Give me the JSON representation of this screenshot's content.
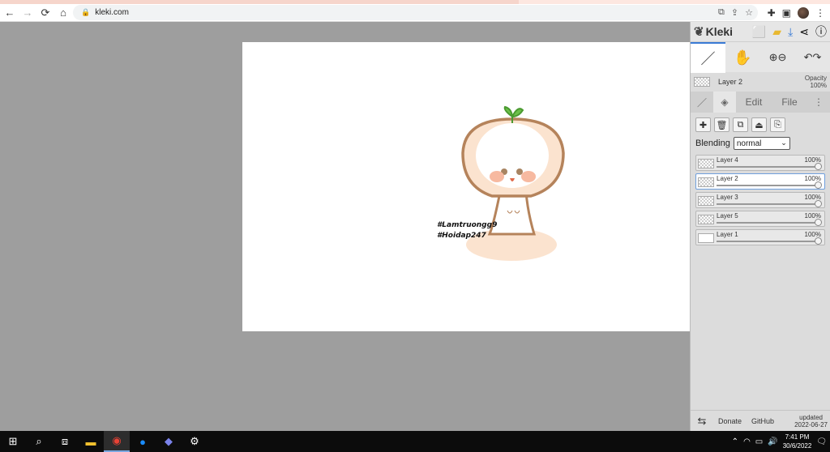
{
  "browser": {
    "url": "kleki.com",
    "nav": {
      "back": "←",
      "forward": "→",
      "reload": "⟳",
      "home": "⌂"
    }
  },
  "kleki": {
    "brand": "Kleki",
    "current_layer": {
      "name": "Layer 2",
      "opacity_label": "Opacity",
      "opacity_value": "100%"
    },
    "tabs": {
      "edit": "Edit",
      "file": "File"
    },
    "blending": {
      "label": "Blending",
      "value": "normal"
    },
    "layers": [
      {
        "name": "Layer 4",
        "opacity": "100%",
        "selected": false
      },
      {
        "name": "Layer 2",
        "opacity": "100%",
        "selected": true
      },
      {
        "name": "Layer 3",
        "opacity": "100%",
        "selected": false
      },
      {
        "name": "Layer 5",
        "opacity": "100%",
        "selected": false
      },
      {
        "name": "Layer 1",
        "opacity": "100%",
        "selected": false
      }
    ],
    "footer": {
      "donate": "Donate",
      "github": "GitHub",
      "updated_label": "updated",
      "updated_date": "2022-06-27"
    }
  },
  "canvas_text": {
    "line1": "#Lamtruongg9",
    "line2": "#Hoidap247"
  },
  "taskbar": {
    "time": "7:41 PM",
    "date": "30/6/2022"
  },
  "colors": {
    "workspace": "#9e9e9e",
    "accent": "#3a7bd5",
    "drawing_outline": "#b5835b",
    "drawing_fill": "#fbe3cf",
    "sprout": "#6cc04a"
  }
}
